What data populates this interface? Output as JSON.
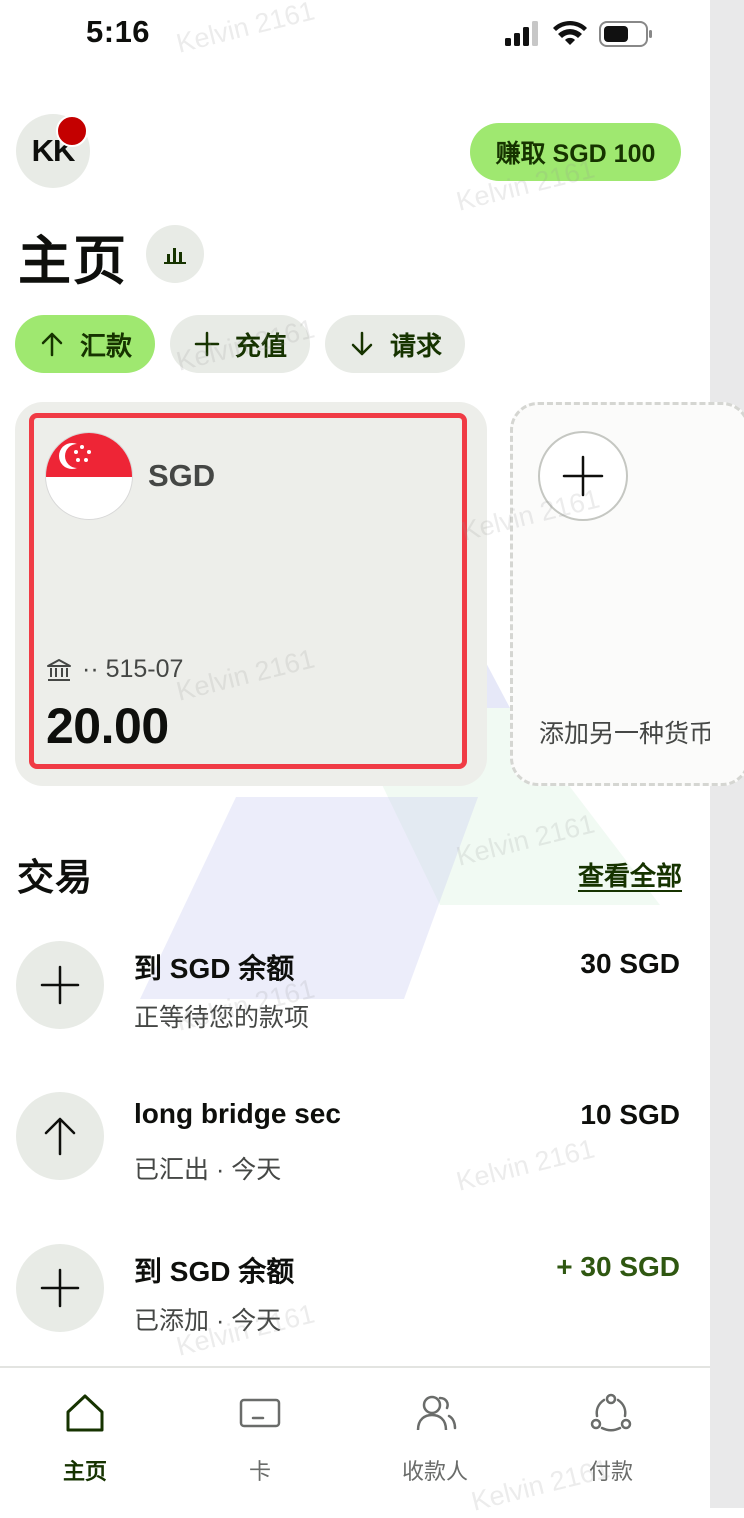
{
  "status_bar": {
    "time": "5:16"
  },
  "header": {
    "avatar_initials": "KK",
    "earn_button": "赚取 SGD 100"
  },
  "page": {
    "title": "主页"
  },
  "actions": [
    {
      "label": "汇款",
      "icon": "arrow-up-icon"
    },
    {
      "label": "充值",
      "icon": "plus-icon"
    },
    {
      "label": "请求",
      "icon": "arrow-down-icon"
    }
  ],
  "balance_card": {
    "currency": "SGD",
    "flag": "singapore-flag",
    "account": "·· 515-07",
    "amount": "20.00"
  },
  "add_currency": {
    "label": "添加另一种货币"
  },
  "transactions": {
    "title": "交易",
    "see_all": "查看全部",
    "items": [
      {
        "icon": "plus-icon",
        "title": "到 SGD 余额",
        "subtitle": "正等待您的款项",
        "amount": "30 SGD"
      },
      {
        "icon": "arrow-up-icon",
        "title": "long bridge sec",
        "subtitle": "已汇出 · 今天",
        "amount": "10 SGD"
      },
      {
        "icon": "plus-icon",
        "title": "到 SGD 余额",
        "subtitle": "已添加 · 今天",
        "amount": "+ 30 SGD"
      }
    ]
  },
  "bottom_nav": [
    {
      "label": "主页",
      "icon": "home-icon",
      "active": true
    },
    {
      "label": "卡",
      "icon": "card-icon",
      "active": false
    },
    {
      "label": "收款人",
      "icon": "recipients-icon",
      "active": false
    },
    {
      "label": "付款",
      "icon": "payments-icon",
      "active": false
    }
  ],
  "watermark": "Kelvin 2161",
  "colors": {
    "accent": "#9fe870",
    "accent_text": "#163300",
    "highlight": "#f03b45",
    "positive": "#2f5711"
  }
}
